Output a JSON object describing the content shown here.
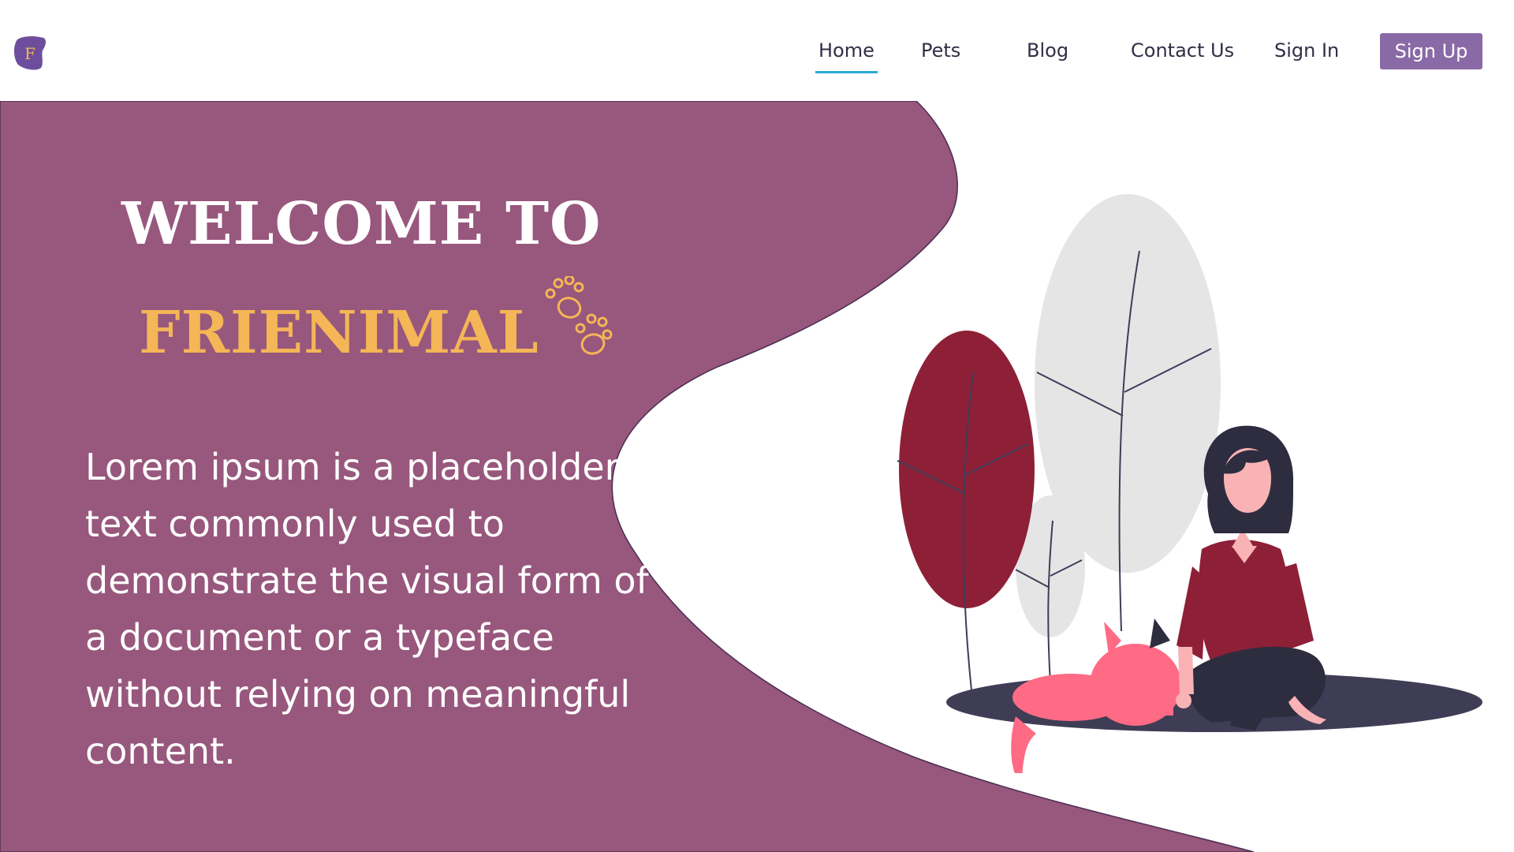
{
  "nav": {
    "logo_letter": "F",
    "items": [
      {
        "label": "Home",
        "active": true
      },
      {
        "label": "Pets",
        "active": false
      },
      {
        "label": "Blog",
        "active": false
      },
      {
        "label": "Contact Us",
        "active": false
      },
      {
        "label": "Sign In",
        "active": false
      }
    ],
    "signup_label": "Sign Up"
  },
  "hero": {
    "title_line1": "WELCOME TO",
    "title_line2": "FRIENIMAL",
    "description": "Lorem ipsum is a placeholder text commonly used to demonstrate the visual form of a document or a typeface without relying on meaningful content."
  },
  "icons": {
    "logo": "logo-icon",
    "paws": "paw-prints-icon",
    "illustration": "woman-with-cat-illustration"
  },
  "colors": {
    "hero_background": "#98577c",
    "accent_yellow": "#f4b656",
    "signup_button": "#8a6aa6",
    "active_underline": "#2aa9d6",
    "tree_red": "#8d2037",
    "tree_gray": "#e5e5e6",
    "shadow": "#3f3d55",
    "cat_pink": "#ff6b85",
    "shirt": "#8d2037",
    "hair": "#2e2d3f",
    "skin": "#f9b3b5"
  }
}
